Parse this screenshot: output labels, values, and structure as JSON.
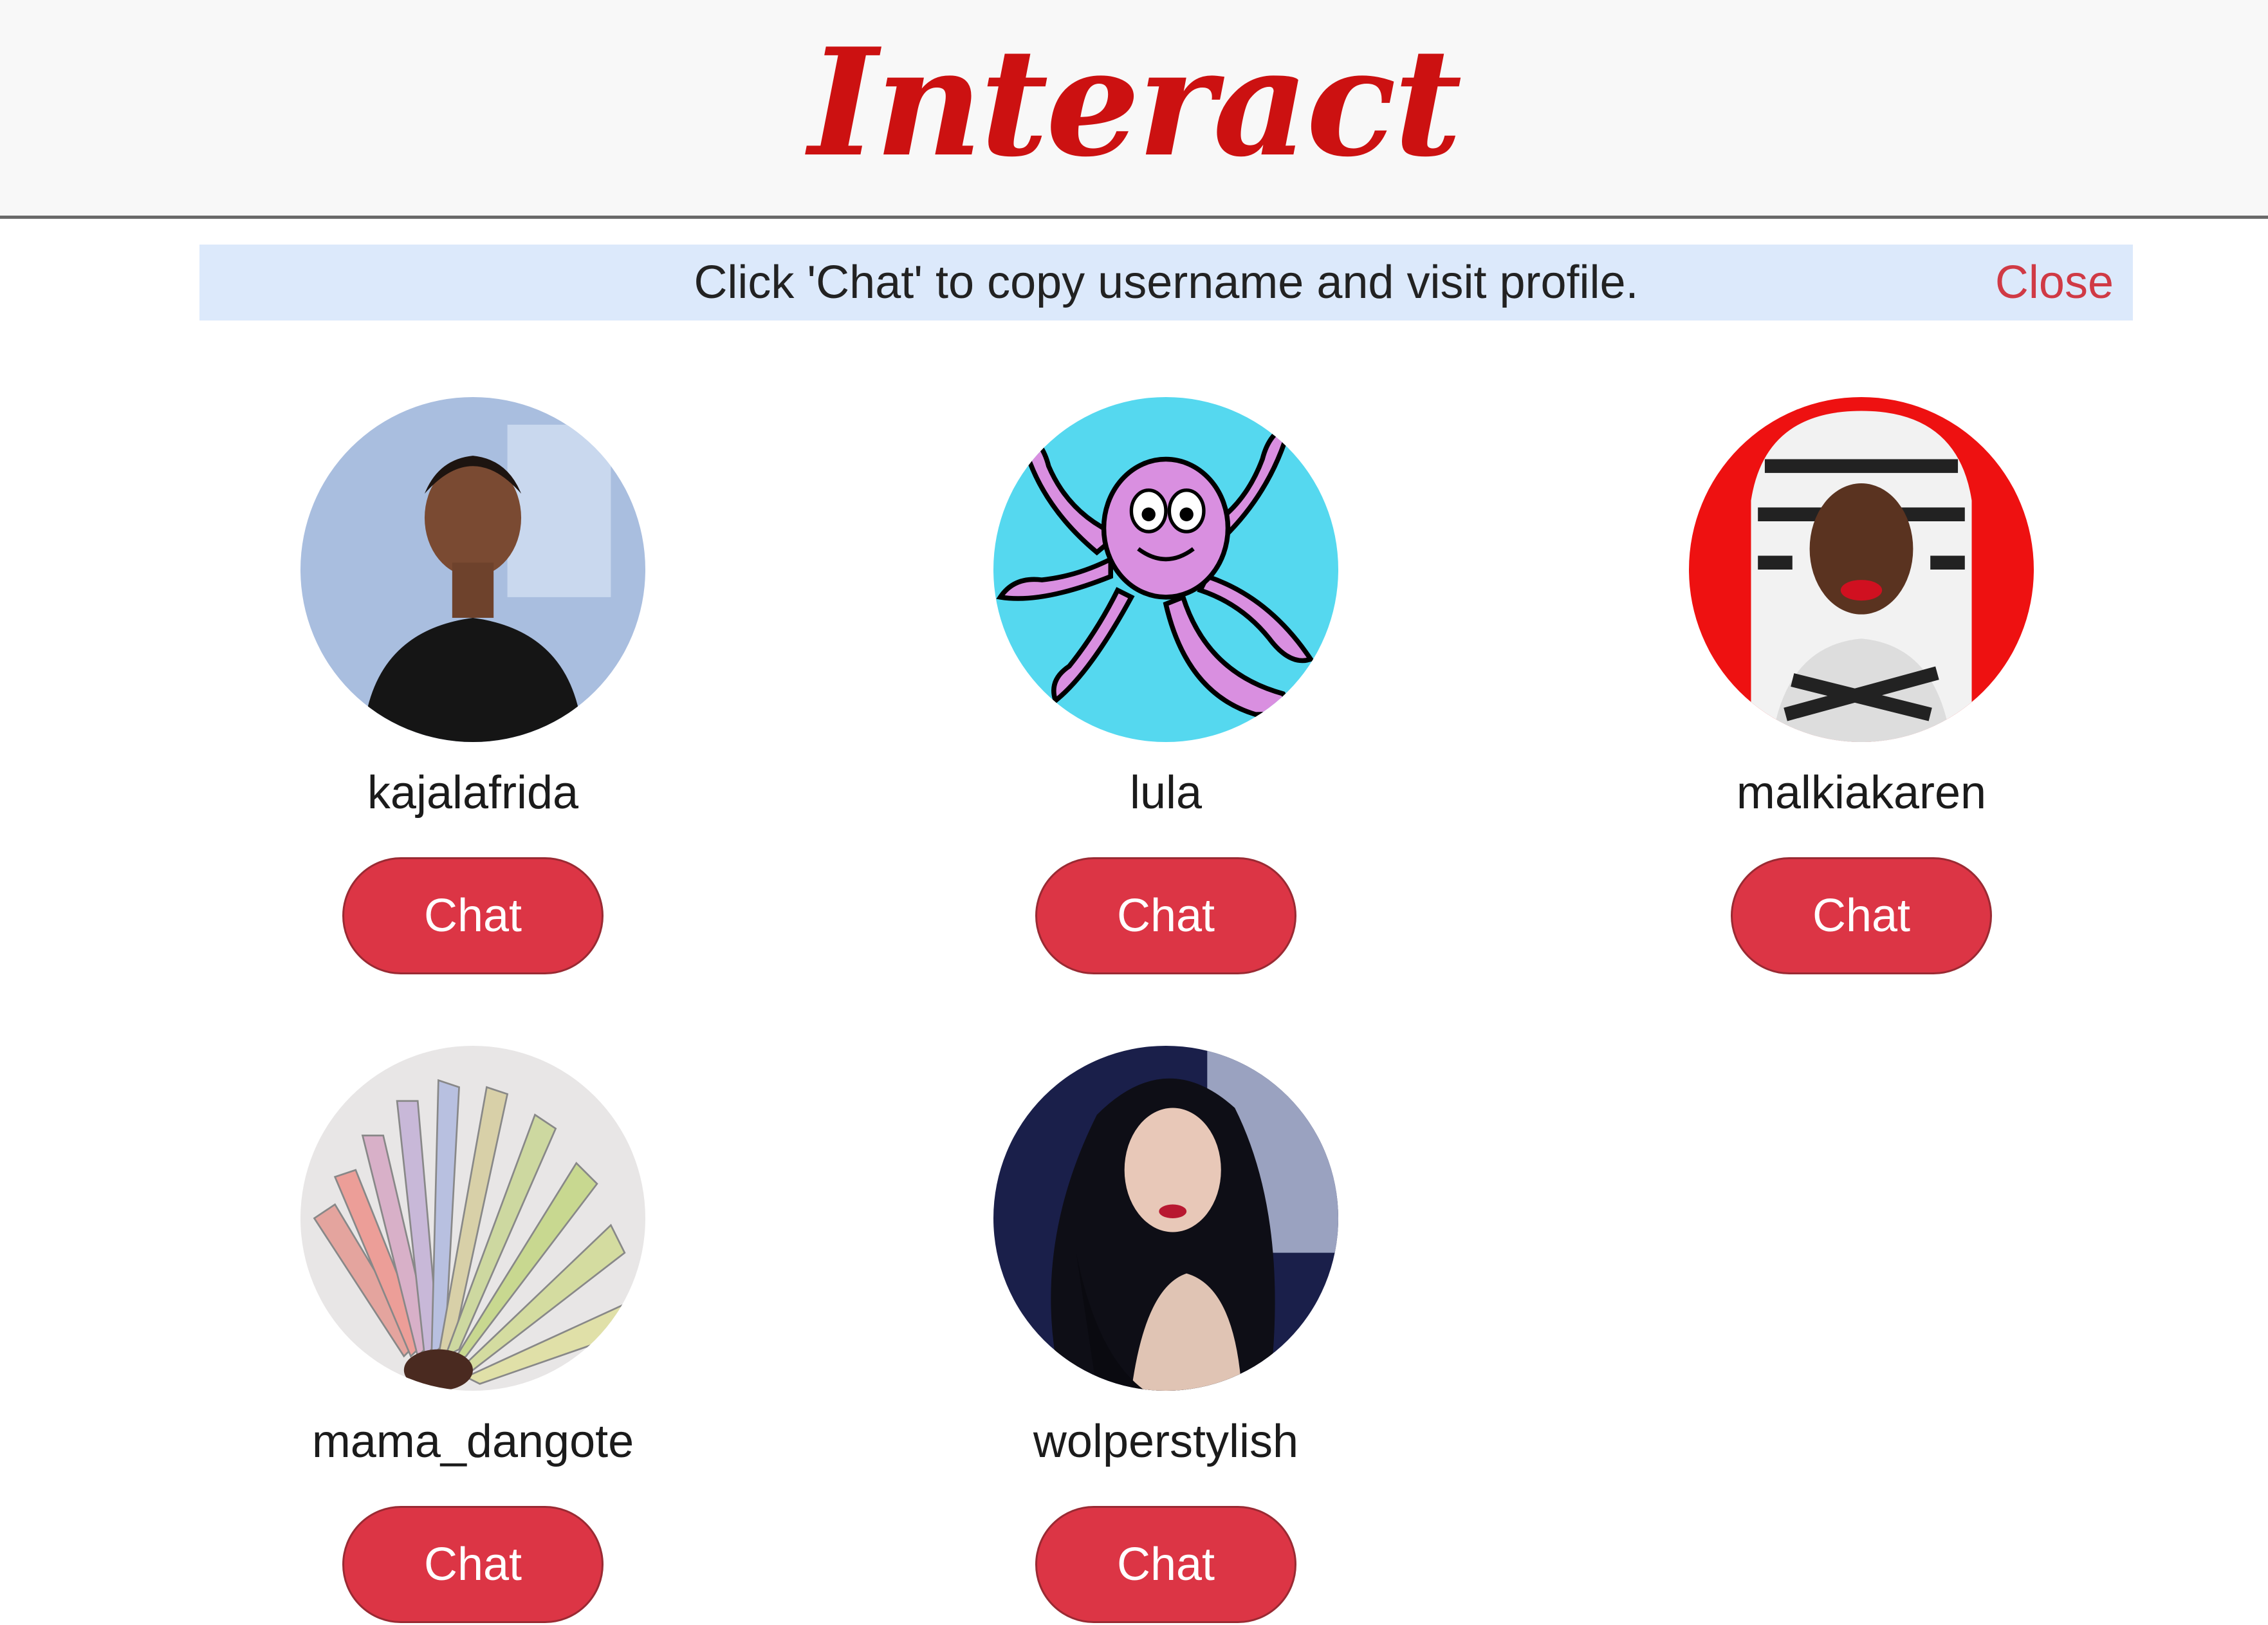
{
  "header": {
    "logo_text": "Interact"
  },
  "notice": {
    "message": "Click 'Chat' to copy username and visit profile.",
    "close_label": "Close"
  },
  "colors": {
    "brand_red": "#cc1111",
    "button_red": "#dc3545",
    "notice_bg": "#dce9fb"
  },
  "profiles": [
    {
      "username": "kajalafrida",
      "chat_label": "Chat",
      "avatar": "woman-portrait-photo"
    },
    {
      "username": "lula",
      "chat_label": "Chat",
      "avatar": "purple-octopus-cartoon"
    },
    {
      "username": "malkiakaren",
      "chat_label": "Chat",
      "avatar": "woman-headscarf-red-background"
    },
    {
      "username": "mama_dangote",
      "chat_label": "Chat",
      "avatar": "banknotes-fan-photo"
    },
    {
      "username": "wolperstylish",
      "chat_label": "Chat",
      "avatar": "woman-dark-hair-photo"
    }
  ]
}
